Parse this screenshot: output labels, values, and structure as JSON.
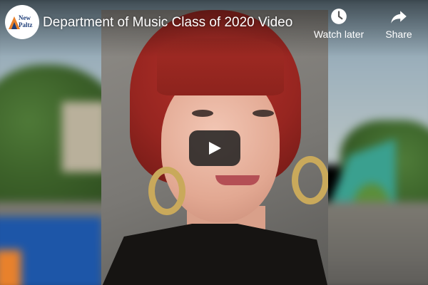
{
  "video": {
    "title": "Department of Music Class of 2020 Video"
  },
  "channel_logo": {
    "line1": "New",
    "line2": "Paltz"
  },
  "actions": {
    "watch_later_label": "Watch later",
    "share_label": "Share"
  },
  "icons": {
    "watch_later": "clock-icon",
    "share": "share-arrow-icon",
    "play": "play-icon"
  },
  "colors": {
    "play_button_bg": "#212121",
    "overlay_text": "#ffffff"
  }
}
